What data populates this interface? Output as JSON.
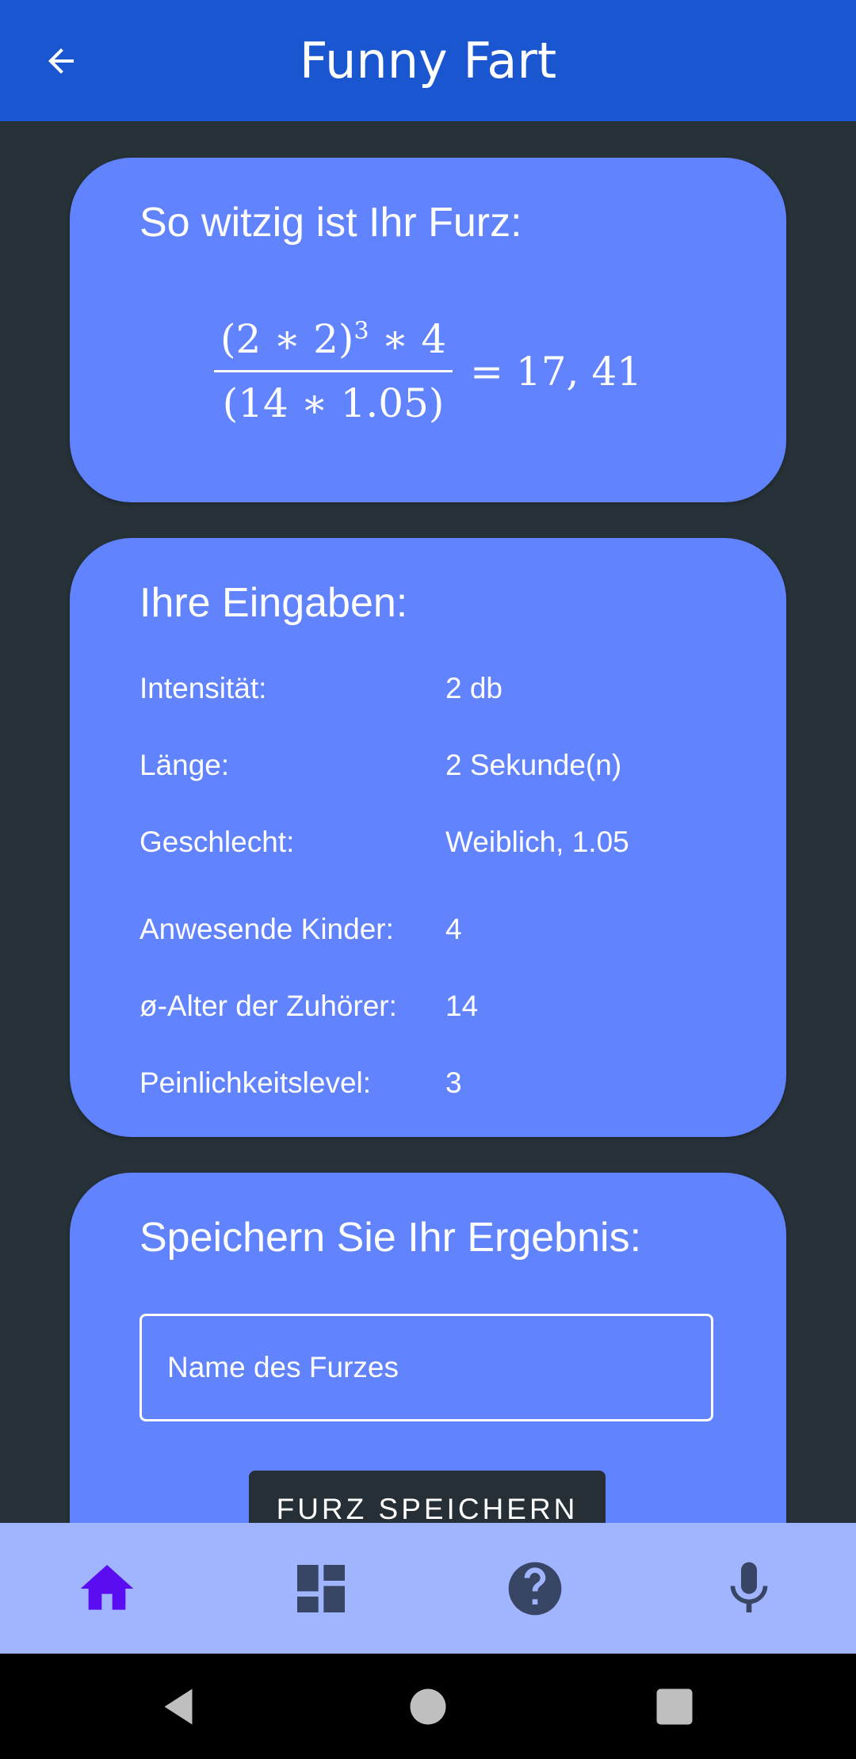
{
  "app_bar": {
    "title": "Funny Fart",
    "back_icon": "arrow-back-icon"
  },
  "result_card": {
    "heading": "So witzig ist Ihr Furz:",
    "formula": {
      "numerator": "(2 ∗ 2)",
      "exponent": "3",
      "numerator_rest": " ∗ 4",
      "denominator": "(14 ∗ 1.05)",
      "result": "= 17, 41"
    }
  },
  "inputs_card": {
    "heading": "Ihre Eingaben:",
    "rows": [
      {
        "label": "Intensität:",
        "value": "2 db"
      },
      {
        "label": "Länge:",
        "value": "2 Sekunde(n)"
      },
      {
        "label": "Geschlecht:",
        "value": "Weiblich, 1.05"
      },
      {
        "label": "Anwesende Kinder:",
        "value": "4"
      },
      {
        "label": "ø-Alter der Zuhörer:",
        "value": "14"
      },
      {
        "label": "Peinlichkeitslevel:",
        "value": "3"
      }
    ]
  },
  "save_card": {
    "heading": "Speichern Sie Ihr Ergebnis:",
    "name_field": {
      "value": "",
      "placeholder": "Name des Furzes"
    },
    "save_button": "FURZ SPEICHERN"
  },
  "bottom_nav": {
    "items": [
      {
        "icon": "home-icon",
        "active": true
      },
      {
        "icon": "dashboard-icon",
        "active": false
      },
      {
        "icon": "help-icon",
        "active": false
      },
      {
        "icon": "microphone-icon",
        "active": false
      }
    ],
    "active_color": "#5a0df0",
    "inactive_color": "#384565"
  },
  "system_nav": {
    "icons": [
      "back-triangle-icon",
      "home-circle-icon",
      "recents-square-icon"
    ]
  },
  "colors": {
    "app_bar": "#1a56cf",
    "background": "#263238",
    "card": "#6183fd",
    "bottom_nav": "#a0b5fe",
    "button": "#252f35"
  }
}
